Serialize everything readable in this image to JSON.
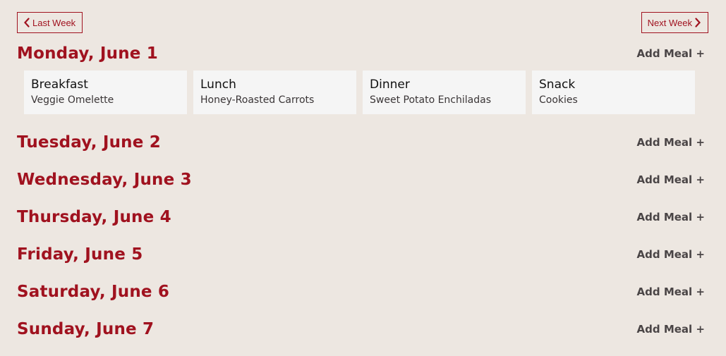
{
  "nav": {
    "prev_label": "Last Week",
    "next_label": "Next Week"
  },
  "colors": {
    "accent": "#a0121f",
    "background": "#ede7e1",
    "card": "#f5f5f5",
    "add_meal_text": "#4a4546"
  },
  "days": [
    {
      "title": "Monday, June 1",
      "add_label": "Add Meal +",
      "meals": [
        {
          "type": "Breakfast",
          "name": "Veggie Omelette"
        },
        {
          "type": "Lunch",
          "name": "Honey-Roasted Carrots"
        },
        {
          "type": "Dinner",
          "name": "Sweet Potato Enchiladas"
        },
        {
          "type": "Snack",
          "name": "Cookies"
        }
      ]
    },
    {
      "title": "Tuesday, June 2",
      "add_label": "Add Meal +"
    },
    {
      "title": "Wednesday, June 3",
      "add_label": "Add Meal +"
    },
    {
      "title": "Thursday, June 4",
      "add_label": "Add Meal +"
    },
    {
      "title": "Friday, June 5",
      "add_label": "Add Meal +"
    },
    {
      "title": "Saturday, June 6",
      "add_label": "Add Meal +"
    },
    {
      "title": "Sunday, June 7",
      "add_label": "Add Meal +"
    }
  ]
}
